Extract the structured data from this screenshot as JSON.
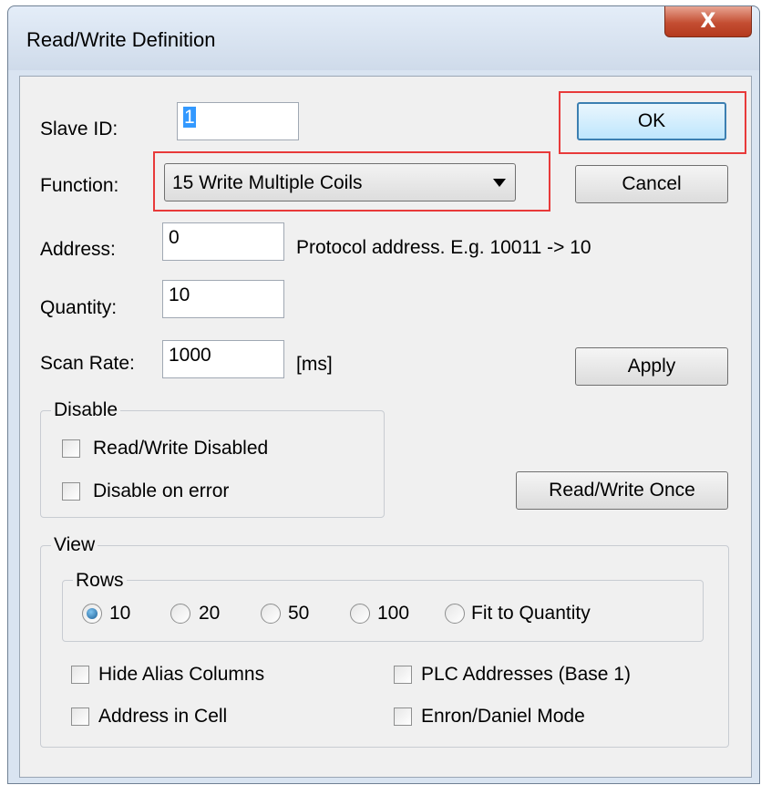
{
  "window": {
    "title": "Read/Write Definition",
    "close_symbol": "X"
  },
  "fields": {
    "slave_id": {
      "label": "Slave ID:",
      "value": "1"
    },
    "function": {
      "label": "Function:",
      "value": "15 Write Multiple Coils"
    },
    "address": {
      "label": "Address:",
      "value": "0",
      "hint": "Protocol address. E.g. 10011 -> 10"
    },
    "quantity": {
      "label": "Quantity:",
      "value": "10"
    },
    "scan_rate": {
      "label": "Scan Rate:",
      "value": "1000",
      "unit": "[ms]"
    }
  },
  "buttons": {
    "ok": "OK",
    "cancel": "Cancel",
    "apply": "Apply",
    "read_write_once": "Read/Write Once"
  },
  "disable_group": {
    "legend": "Disable",
    "items": [
      {
        "label": "Read/Write Disabled",
        "checked": false
      },
      {
        "label": "Disable on error",
        "checked": false
      }
    ]
  },
  "view_group": {
    "legend": "View",
    "rows": {
      "legend": "Rows",
      "options": [
        {
          "label": "10",
          "selected": true
        },
        {
          "label": "20",
          "selected": false
        },
        {
          "label": "50",
          "selected": false
        },
        {
          "label": "100",
          "selected": false
        },
        {
          "label": "Fit to Quantity",
          "selected": false
        }
      ]
    },
    "checkboxes": [
      {
        "label": "Hide Alias Columns",
        "checked": false
      },
      {
        "label": "PLC Addresses (Base 1)",
        "checked": false
      },
      {
        "label": "Address in Cell",
        "checked": false
      },
      {
        "label": "Enron/Daniel Mode",
        "checked": false
      }
    ]
  },
  "colors": {
    "highlight_box": "#e83a3a",
    "selection": "#3399ff",
    "close_button": "#c44e32"
  }
}
